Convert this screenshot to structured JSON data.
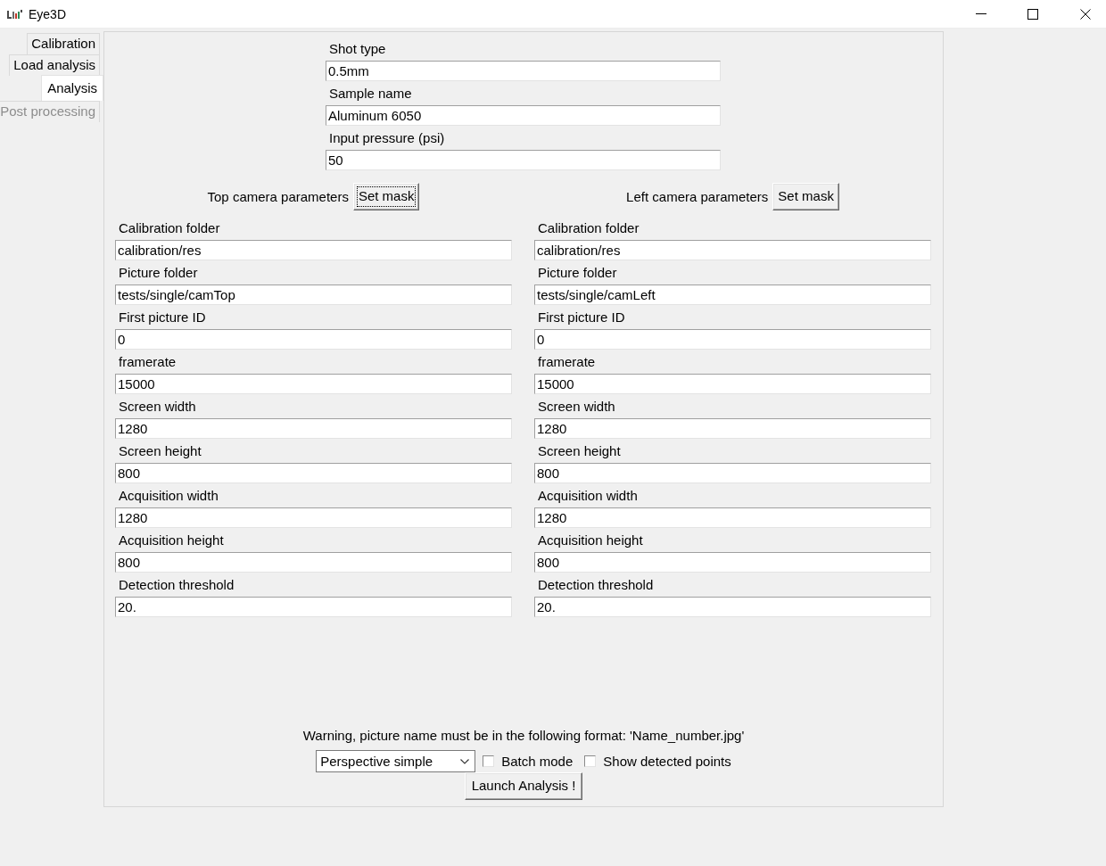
{
  "window": {
    "title": "Eye3D"
  },
  "tabs": [
    {
      "label": "Calibration",
      "selected": false,
      "disabled": false
    },
    {
      "label": "Load analysis",
      "selected": false,
      "disabled": false
    },
    {
      "label": "Analysis",
      "selected": true,
      "disabled": false
    },
    {
      "label": "Post processing",
      "selected": false,
      "disabled": true
    }
  ],
  "shot_fields": [
    {
      "label": "Shot type",
      "value": "0.5mm"
    },
    {
      "label": "Sample name",
      "value": "Aluminum 6050"
    },
    {
      "label": "Input pressure (psi)",
      "value": "50"
    }
  ],
  "cameras": [
    {
      "title": "Top camera parameters",
      "mask_button": {
        "label": "Set mask",
        "focused": true
      },
      "fields": [
        {
          "label": "Calibration folder",
          "value": "calibration/res"
        },
        {
          "label": "Picture folder",
          "value": "tests/single/camTop"
        },
        {
          "label": "First picture ID",
          "value": "0"
        },
        {
          "label": "framerate",
          "value": "15000"
        },
        {
          "label": "Screen width",
          "value": "1280"
        },
        {
          "label": "Screen height",
          "value": "800"
        },
        {
          "label": "Acquisition width",
          "value": "1280"
        },
        {
          "label": "Acquisition height",
          "value": "800"
        },
        {
          "label": "Detection threshold",
          "value": "20."
        }
      ]
    },
    {
      "title": "Left camera parameters",
      "mask_button": {
        "label": "Set mask",
        "focused": false
      },
      "fields": [
        {
          "label": "Calibration folder",
          "value": "calibration/res"
        },
        {
          "label": "Picture folder",
          "value": "tests/single/camLeft"
        },
        {
          "label": "First picture ID",
          "value": "0"
        },
        {
          "label": "framerate",
          "value": "15000"
        },
        {
          "label": "Screen width",
          "value": "1280"
        },
        {
          "label": "Screen height",
          "value": "800"
        },
        {
          "label": "Acquisition width",
          "value": "1280"
        },
        {
          "label": "Acquisition height",
          "value": "800"
        },
        {
          "label": "Detection threshold",
          "value": "20."
        }
      ]
    }
  ],
  "warning": "Warning, picture name must be in the following format: 'Name_number.jpg'",
  "mode_select": {
    "value": "Perspective simple"
  },
  "options": [
    {
      "label": "Batch mode",
      "checked": false
    },
    {
      "label": "Show detected points",
      "checked": false
    }
  ],
  "launch_button": {
    "label": "Launch Analysis !"
  }
}
